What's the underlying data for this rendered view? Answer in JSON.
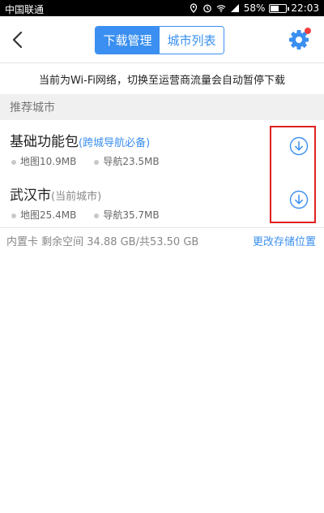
{
  "status_bar": {
    "carrier": "中国联通",
    "battery": "58%",
    "battery_fraction": 0.58,
    "time": "22:03"
  },
  "header": {
    "tabs": [
      {
        "label": "下载管理",
        "active": true
      },
      {
        "label": "城市列表",
        "active": false
      }
    ],
    "icons": {
      "back": "back-arrow-icon",
      "settings": "gear-icon"
    },
    "colors": {
      "accent": "#3a8ff0",
      "badge": "#f04040"
    }
  },
  "notice": "当前为Wi-Fi网络，切换至运营商流量会自动暂停下载",
  "section_title": "推荐城市",
  "cities": [
    {
      "name": "基础功能包",
      "hint": "(跨城导航必备)",
      "map": "地图10.9MB",
      "nav": "导航23.5MB"
    },
    {
      "name": "武汉市",
      "hint": "(当前城市)",
      "map": "地图25.4MB",
      "nav": "导航35.7MB"
    }
  ],
  "storage": {
    "info": "内置卡 剩余空间 34.88 GB/共53.50 GB",
    "change": "更改存储位置"
  }
}
